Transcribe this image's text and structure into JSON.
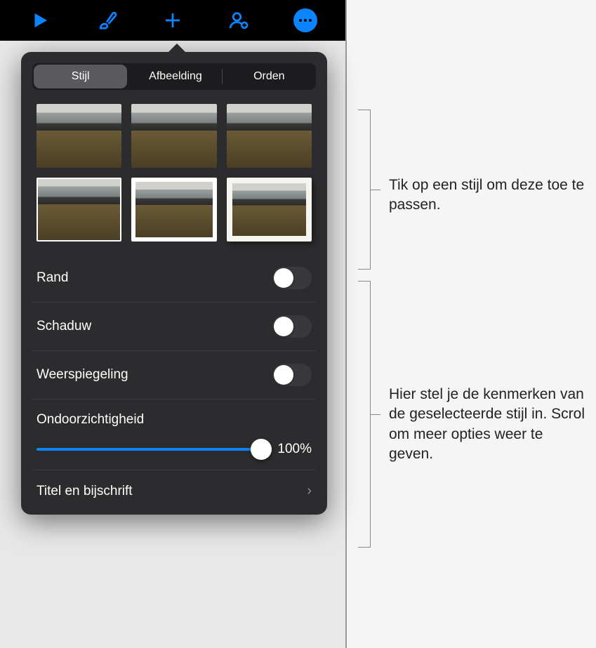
{
  "toolbar": {
    "play_icon": "play-icon",
    "brush_icon": "brush-icon",
    "add_icon": "plus-icon",
    "collaborate_icon": "person-plus-icon",
    "more_icon": "ellipsis-icon"
  },
  "popover": {
    "tabs": [
      {
        "label": "Stijl",
        "active": true
      },
      {
        "label": "Afbeelding",
        "active": false
      },
      {
        "label": "Orden",
        "active": false
      }
    ],
    "style_thumbs": [
      "plain",
      "plain",
      "plain",
      "outlined",
      "framed",
      "matte"
    ],
    "rows": {
      "border": {
        "label": "Rand",
        "on": false
      },
      "shadow": {
        "label": "Schaduw",
        "on": false
      },
      "reflection": {
        "label": "Weerspiegeling",
        "on": false
      },
      "opacity": {
        "label": "Ondoorzichtigheid",
        "value": "100%"
      },
      "title_caption": {
        "label": "Titel en bijschrift"
      }
    }
  },
  "callouts": {
    "styles": "Tik op een stijl om deze toe te passen.",
    "attrs": "Hier stel je de kenmerken van de geselecteerde stijl in. Scrol om meer opties weer te geven."
  }
}
